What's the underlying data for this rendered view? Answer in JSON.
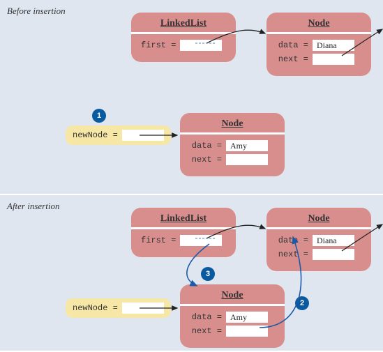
{
  "section_before": "Before insertion",
  "section_after": "After insertion",
  "linkedlist_title": "LinkedList",
  "node_title": "Node",
  "first_label": "first =",
  "data_label": "data =",
  "next_label": "next =",
  "newnode_label": "newNode =",
  "diana": "Diana",
  "amy": "Amy",
  "step1": "1",
  "step2": "2",
  "step3": "3"
}
